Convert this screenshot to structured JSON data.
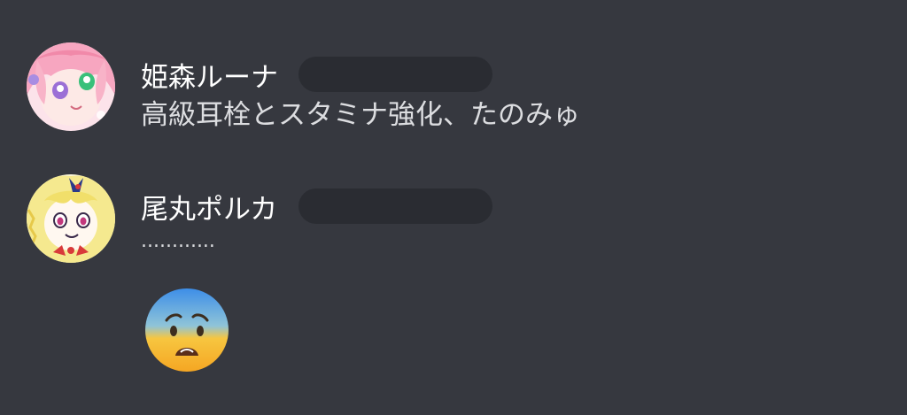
{
  "messages": [
    {
      "username": "姫森ルーナ",
      "text": "高級耳栓とスタミナ強化、たのみゅ",
      "avatar_icon": "pink-haired-girl-avatar"
    },
    {
      "username": "尾丸ポルカ",
      "text": "............",
      "avatar_icon": "blonde-girl-avatar",
      "emoji": "anxious-face-with-sweat"
    }
  ],
  "colors": {
    "background": "#36383f",
    "username": "#ffffff",
    "message": "#dcdde0",
    "redaction": "#2a2c32"
  }
}
